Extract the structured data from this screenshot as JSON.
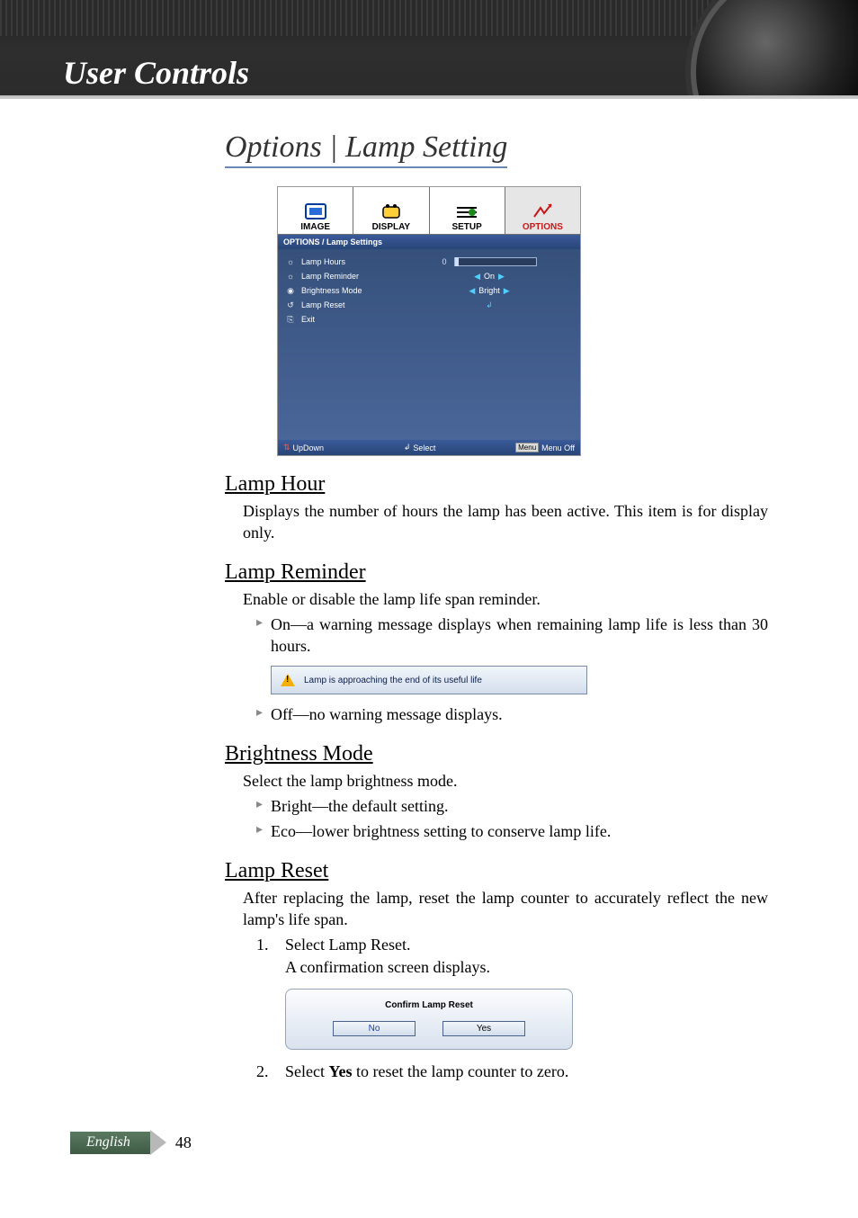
{
  "header": {
    "section": "User Controls"
  },
  "page_title": "Options | Lamp Setting",
  "osd": {
    "tabs": [
      "IMAGE",
      "DISPLAY",
      "SETUP",
      "OPTIONS"
    ],
    "breadcrumb": "OPTIONS / Lamp Settings",
    "rows": {
      "lamp_hours": {
        "label": "Lamp Hours",
        "value": "0"
      },
      "lamp_reminder": {
        "label": "Lamp Reminder",
        "value": "On"
      },
      "brightness_mode": {
        "label": "Brightness Mode",
        "value": "Bright"
      },
      "lamp_reset": {
        "label": "Lamp Reset"
      },
      "exit": {
        "label": "Exit"
      }
    },
    "footer": {
      "updown": "UpDown",
      "select": "Select",
      "menu_off": "Menu Off",
      "menu_pill": "Menu"
    }
  },
  "sections": {
    "lamp_hour": {
      "title": "Lamp Hour",
      "desc": "Displays the number of hours the lamp has been active. This item is for display only."
    },
    "lamp_reminder": {
      "title": "Lamp Reminder",
      "desc": "Enable or disable the lamp life span reminder.",
      "on": "On—a warning message displays when remaining lamp life is less than 30 hours.",
      "off": "Off—no warning message displays.",
      "warn": "Lamp is approaching the end of its useful life"
    },
    "brightness_mode": {
      "title": "Brightness Mode",
      "desc": "Select the lamp brightness mode.",
      "bright": "Bright—the default setting.",
      "eco": "Eco—lower brightness setting to conserve lamp life."
    },
    "lamp_reset": {
      "title": "Lamp Reset",
      "desc": "After replacing the lamp, reset the lamp counter to accurately reflect the new lamp's life span.",
      "step1_a": "Select Lamp Reset.",
      "step1_b": "A confirmation screen displays.",
      "step2_pre": "Select ",
      "step2_bold": "Yes",
      "step2_post": " to reset the lamp counter to zero.",
      "confirm": {
        "title": "Confirm Lamp Reset",
        "no": "No",
        "yes": "Yes"
      }
    }
  },
  "footer": {
    "language": "English",
    "page": "48"
  }
}
